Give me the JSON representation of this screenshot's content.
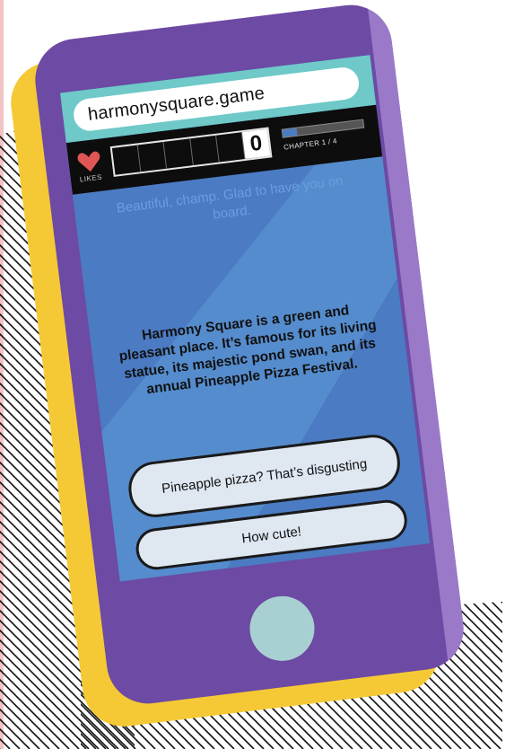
{
  "browser": {
    "url": "harmonysquare.game"
  },
  "hud": {
    "likes_label": "LIKES",
    "score": "0",
    "chapter_label": "CHAPTER 1 / 4",
    "chapter_progress": 0.18
  },
  "game": {
    "previous_message": "Beautiful, champ. Glad to have you on board.",
    "story_text": "Harmony Square is a green and pleasant place. It’s famous for its living statue, its majestic pond swan, and its annual Pineapple Pizza Festival.",
    "choices": [
      {
        "label": "Pineapple pizza? That’s disgusting"
      },
      {
        "label": "How cute!"
      }
    ]
  },
  "icons": {
    "likes": "heart-icon"
  },
  "colors": {
    "phone_body": "#6d4aa3",
    "phone_shadow": "#f5c935",
    "screen": "#4b7bc3",
    "url_strip": "#6ec9c8",
    "heart": "#e05555",
    "home_button": "#a8d0d2"
  }
}
